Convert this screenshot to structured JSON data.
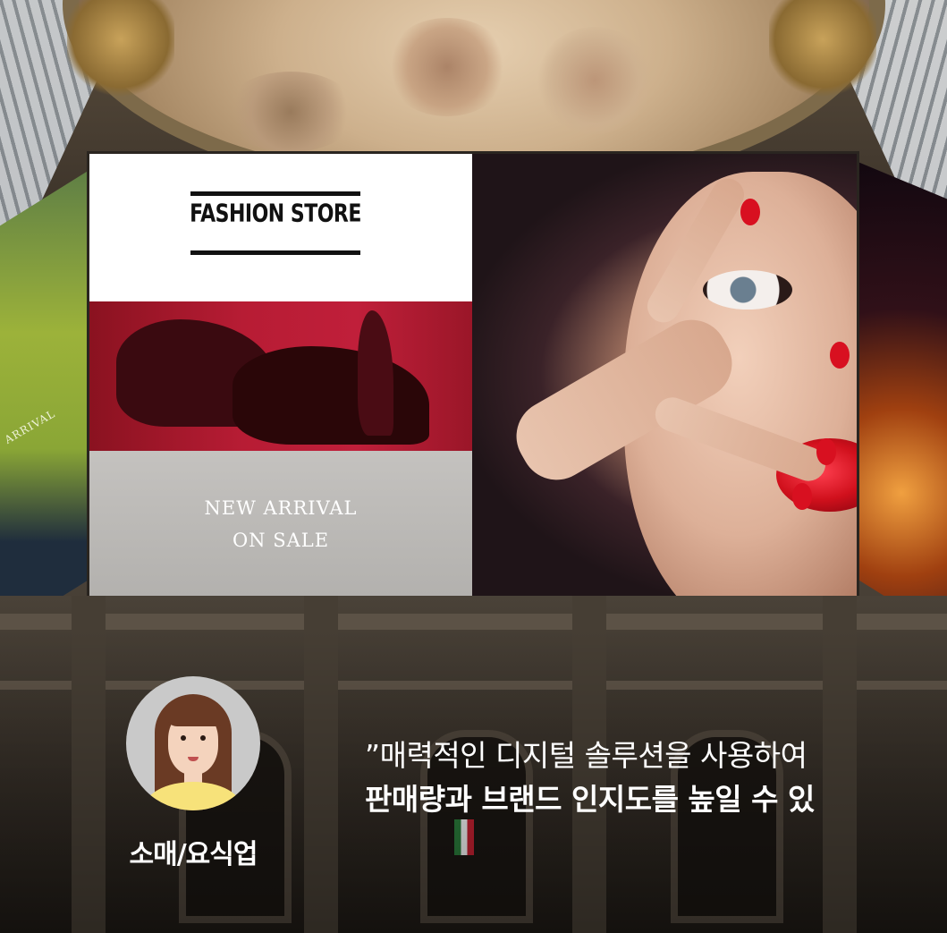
{
  "billboard": {
    "brand": "FASHION STORE",
    "promo_line1": "NEW ARRIVAL",
    "promo_line2": "ON SALE"
  },
  "side_banner": {
    "text": "ARRIVAL"
  },
  "testimonial": {
    "category": "소매/요식업",
    "quote_line1": "”매력적인 디지털 솔루션을 사용하여",
    "quote_line2": "판매량과 브랜드 인지도를 높일 수 있"
  },
  "colors": {
    "accent_red": "#c01f3a",
    "text": "#ffffff"
  }
}
